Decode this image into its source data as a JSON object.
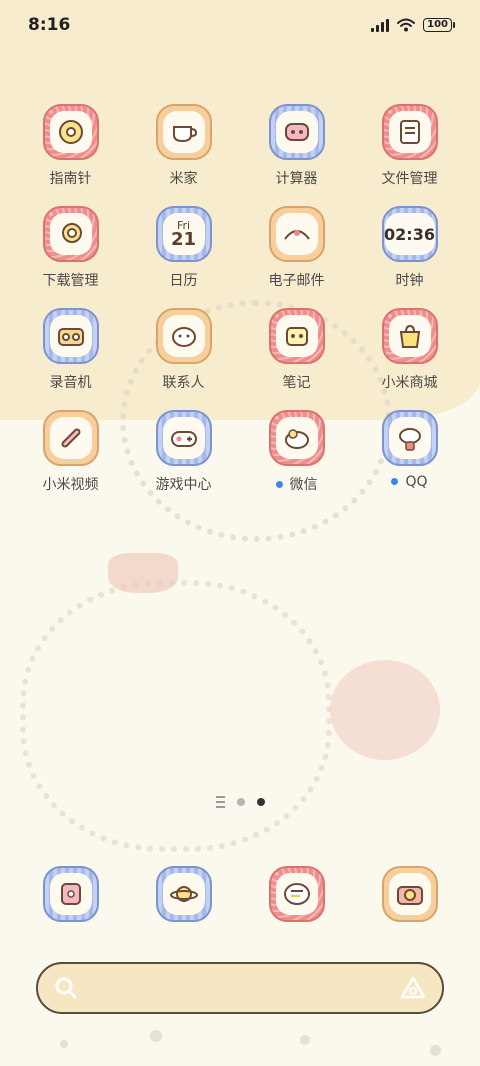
{
  "status": {
    "time": "8:16",
    "battery": "100"
  },
  "apps": [
    {
      "label": "指南针",
      "icon": "compass-icon",
      "color": "pink",
      "badge": false
    },
    {
      "label": "米家",
      "icon": "teacup-icon",
      "color": "orange",
      "badge": false
    },
    {
      "label": "计算器",
      "icon": "calculator-icon",
      "color": "blue",
      "badge": false
    },
    {
      "label": "文件管理",
      "icon": "folder-icon",
      "color": "pink",
      "badge": false
    },
    {
      "label": "下载管理",
      "icon": "download-icon",
      "color": "pink",
      "badge": false
    },
    {
      "label": "日历",
      "icon": "calendar-icon",
      "color": "blue",
      "badge": false
    },
    {
      "label": "电子邮件",
      "icon": "mail-icon",
      "color": "orange",
      "badge": false
    },
    {
      "label": "时钟",
      "icon": "clock-icon",
      "color": "blue",
      "badge": false
    },
    {
      "label": "录音机",
      "icon": "recorder-icon",
      "color": "blue",
      "badge": false
    },
    {
      "label": "联系人",
      "icon": "contacts-icon",
      "color": "orange",
      "badge": false
    },
    {
      "label": "笔记",
      "icon": "notes-icon",
      "color": "pink",
      "badge": false
    },
    {
      "label": "小米商城",
      "icon": "shopping-bag-icon",
      "color": "pink",
      "badge": false
    },
    {
      "label": "小米视频",
      "icon": "video-icon",
      "color": "orange",
      "badge": false
    },
    {
      "label": "游戏中心",
      "icon": "gamepad-icon",
      "color": "blue",
      "badge": false
    },
    {
      "label": "微信",
      "icon": "wechat-icon",
      "color": "pink",
      "badge": true
    },
    {
      "label": "QQ",
      "icon": "qq-icon",
      "color": "blue",
      "badge": true
    }
  ],
  "calendar": {
    "day": "Fri",
    "date": "21"
  },
  "clock": {
    "time": "02:36"
  },
  "dock": [
    {
      "icon": "phone-icon",
      "color": "blue"
    },
    {
      "icon": "browser-icon",
      "color": "blue"
    },
    {
      "icon": "messages-icon",
      "color": "pink"
    },
    {
      "icon": "camera-icon",
      "color": "orange"
    }
  ],
  "pages": {
    "count": 2,
    "active": 1
  },
  "search": {
    "placeholder": ""
  }
}
